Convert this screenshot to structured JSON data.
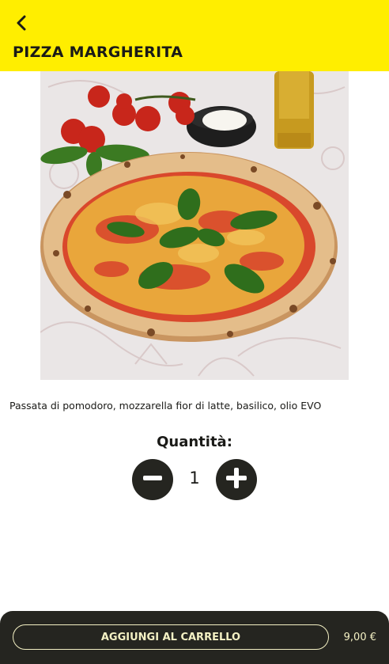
{
  "header": {
    "back_icon": "chevron-left-icon",
    "title": "PIZZA MARGHERITA",
    "background_color": "#ffee00"
  },
  "product": {
    "image_subject": "pizza-margherita-photo",
    "description": "Passata di pomodoro, mozzarella fior di latte, basilico, olio EVO"
  },
  "quantity": {
    "label": "Quantità:",
    "value": "1",
    "minus_icon": "minus-icon",
    "plus_icon": "plus-icon"
  },
  "footer": {
    "add_to_cart_label": "AGGIUNGI AL CARRELLO",
    "price": "9,00 €",
    "background_color": "#252520",
    "accent_color": "#f4f1c4"
  }
}
